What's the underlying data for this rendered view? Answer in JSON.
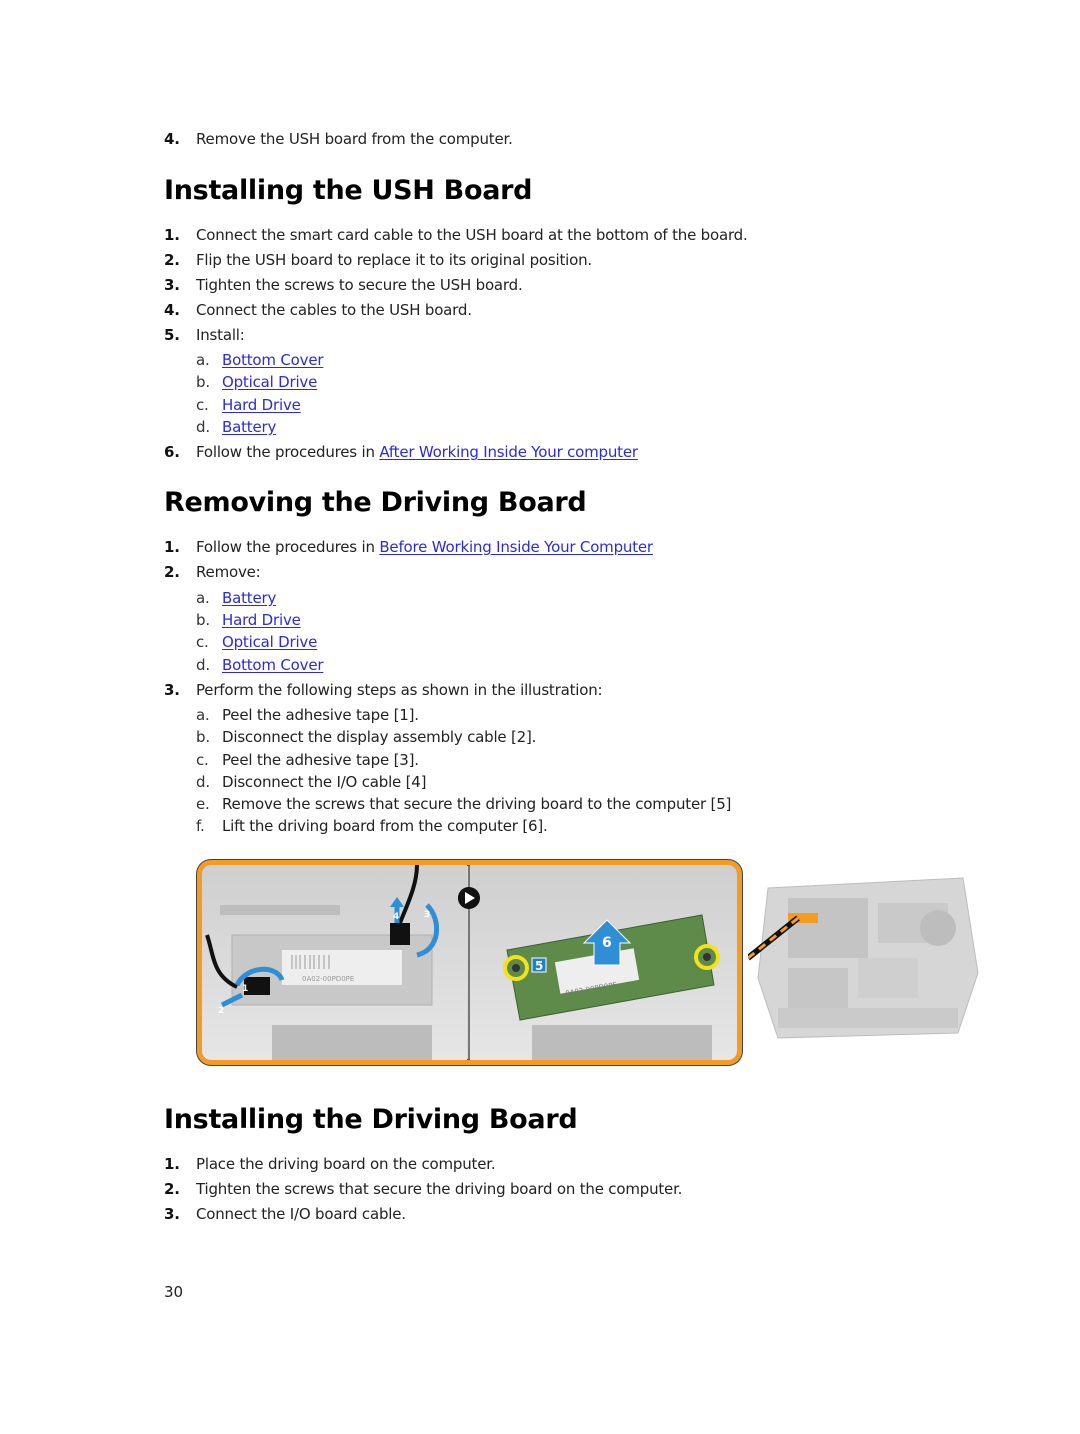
{
  "previous_step": {
    "number": "4.",
    "text": "Remove the USH board from the computer."
  },
  "sections": [
    {
      "title": "Installing the USH Board",
      "steps": [
        {
          "number": "1.",
          "text": "Connect the smart card cable to the USH board at the bottom of the board."
        },
        {
          "number": "2.",
          "text": "Flip the USH board to replace it to its original position."
        },
        {
          "number": "3.",
          "text": "Tighten the screws to secure the USH board."
        },
        {
          "number": "4.",
          "text": "Connect the cables to the USH board."
        },
        {
          "number": "5.",
          "text": "Install:",
          "substeps": [
            {
              "letter": "a.",
              "link": "Bottom Cover"
            },
            {
              "letter": "b.",
              "link": "Optical Drive"
            },
            {
              "letter": "c.",
              "link": "Hard Drive"
            },
            {
              "letter": "d.",
              "link": "Battery"
            }
          ]
        },
        {
          "number": "6.",
          "text": "Follow the procedures in ",
          "link": "After Working Inside Your computer"
        }
      ]
    },
    {
      "title": "Removing the Driving Board",
      "steps": [
        {
          "number": "1.",
          "text": "Follow the procedures in ",
          "link": "Before Working Inside Your Computer"
        },
        {
          "number": "2.",
          "text": "Remove:",
          "substeps": [
            {
              "letter": "a.",
              "link": "Battery"
            },
            {
              "letter": "b.",
              "link": "Hard Drive"
            },
            {
              "letter": "c.",
              "link": "Optical Drive"
            },
            {
              "letter": "d.",
              "link": "Bottom Cover"
            }
          ]
        },
        {
          "number": "3.",
          "text": "Perform the following steps as shown in the illustration:",
          "substeps": [
            {
              "letter": "a.",
              "text": "Peel the adhesive tape [1]."
            },
            {
              "letter": "b.",
              "text": "Disconnect the display assembly cable [2]."
            },
            {
              "letter": "c.",
              "text": "Peel the adhesive tape [3]."
            },
            {
              "letter": "d.",
              "text": "Disconnect the I/O cable [4]"
            },
            {
              "letter": "e.",
              "text": "Remove the screws that secure the driving board to the computer [5]"
            },
            {
              "letter": "f.",
              "text": "Lift the driving board from the computer [6]."
            }
          ]
        }
      ]
    },
    {
      "title": "Installing the Driving Board",
      "steps": [
        {
          "number": "1.",
          "text": "Place the driving board on the computer."
        },
        {
          "number": "2.",
          "text": "Tighten the screws that secure the driving board on the computer."
        },
        {
          "number": "3.",
          "text": "Connect the I/O board cable."
        }
      ]
    }
  ],
  "illustration": {
    "callouts": [
      "1",
      "2",
      "3",
      "4",
      "5",
      "6"
    ],
    "board_label": "0A02-00PD0PE",
    "colors": {
      "frame": "#f59a23",
      "arrow": "#2f8fd6",
      "screw_ring": "#f2e21a",
      "board": "#5e8a4a",
      "callout_box": "#1f7fcc"
    }
  },
  "footer": {
    "page_number": "30"
  },
  "colors": {
    "link": "#2a2ae6",
    "text": "#222222",
    "heading": "#000000"
  }
}
